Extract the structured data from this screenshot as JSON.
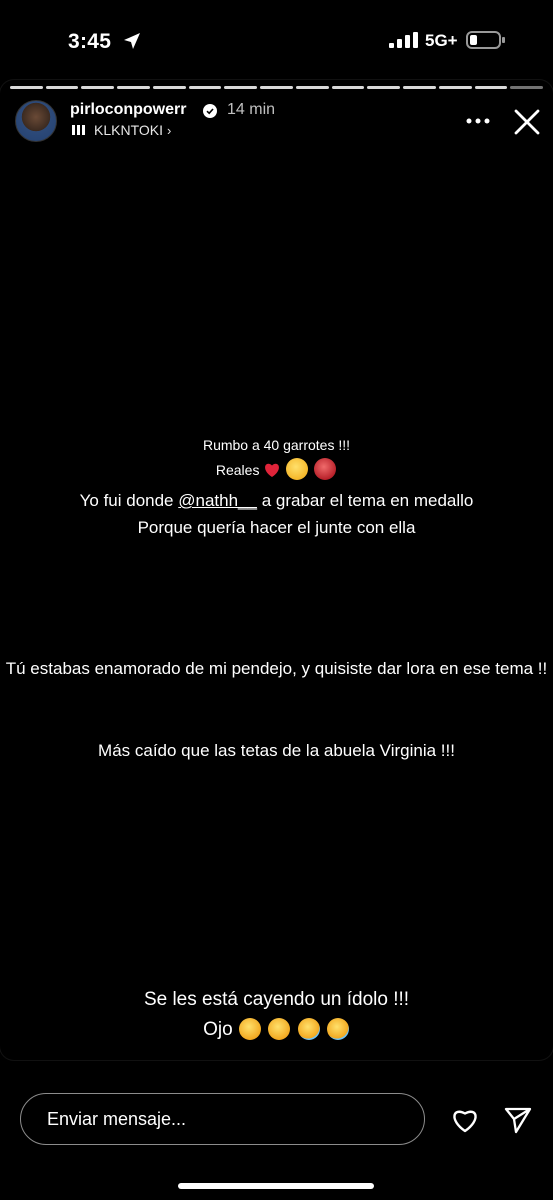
{
  "status": {
    "time": "3:45",
    "network": "5G+",
    "icons": [
      "location-arrow-icon",
      "signal-icon",
      "battery-icon"
    ]
  },
  "story": {
    "progress_segments": 15,
    "username": "pirloconpowerr",
    "time_ago": "14 min",
    "music": "KLKNTOKI",
    "music_chevron": "›",
    "lines": {
      "l1": "Rumbo a 40 garrotes !!!",
      "l2": "Reales",
      "l3_before": "Yo fui donde ",
      "l3_mention": "@nathh__",
      "l3_after": " a grabar el tema en medallo",
      "l4": "Porque quería hacer el junte con ella",
      "l5": "Tú estabas enamorado de mi pendejo, y quisiste dar lora en ese tema !!",
      "l6": "Más caído que las tetas de la abuela Virginia !!!",
      "l7": "Se les está cayendo un ídolo !!!",
      "l8": "Ojo"
    },
    "emojis": {
      "reales": [
        "red-heart-icon",
        "smiling-face-with-hearts-icon",
        "angry-devil-icon"
      ],
      "ojo": [
        "face-peeking-icon",
        "face-peeking-icon",
        "tears-of-joy-icon",
        "tears-of-joy-icon"
      ]
    }
  },
  "footer": {
    "message_placeholder": "Enviar mensaje..."
  },
  "colors": {
    "background": "#000000",
    "text": "#ffffff",
    "heart_red": "#e0243a"
  }
}
